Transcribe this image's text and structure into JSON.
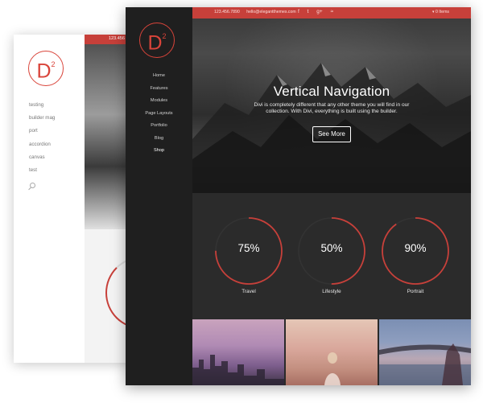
{
  "back_site": {
    "logo_text": "D",
    "logo_sup": "2",
    "nav": [
      "testing",
      "builder mag",
      "port",
      "accordion",
      "canvas",
      "test"
    ],
    "topbar_phone": "123.456"
  },
  "front_site": {
    "logo_text": "D",
    "logo_sup": "2",
    "nav": [
      "Home",
      "Features",
      "Modules",
      "Page Layouts",
      "Portfolio",
      "Blog",
      "Shop"
    ],
    "topbar": {
      "phone": "123.456.7890",
      "email": "hello@elegantthemes.com",
      "social_icons": [
        "facebook-icon",
        "twitter-icon",
        "google-plus-icon",
        "rss-icon"
      ],
      "social_glyphs": [
        "f",
        "t",
        "g+",
        "≈"
      ],
      "cart": "0 Items"
    },
    "hero": {
      "title": "Vertical Navigation",
      "text": "Divi is completely different that any other theme you will find in our collection. With Divi, everything is built using the builder.",
      "button": "See More"
    },
    "stats": [
      {
        "value": "75%",
        "label": "Travel",
        "fraction": 0.75
      },
      {
        "value": "50%",
        "label": "Lifestyle",
        "fraction": 0.5
      },
      {
        "value": "90%",
        "label": "Portrait",
        "fraction": 0.9
      }
    ],
    "accent_color": "#c7403a"
  }
}
